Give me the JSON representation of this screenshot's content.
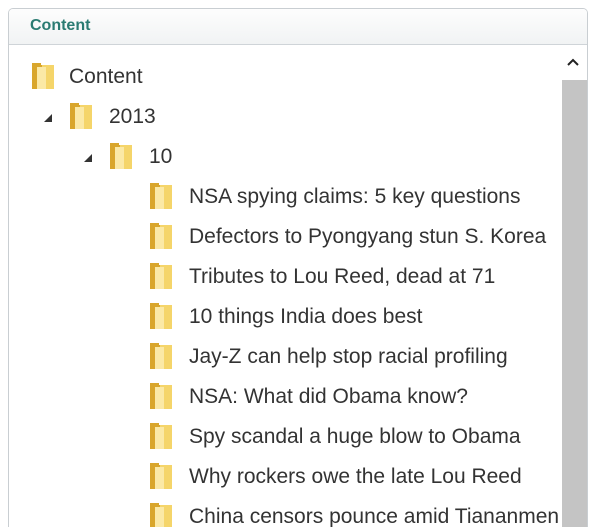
{
  "panel": {
    "title": "Content"
  },
  "tree": {
    "root": {
      "label": "Content",
      "icon": "folder-icon"
    },
    "year": {
      "label": "2013",
      "icon": "folder-icon",
      "expander": "collapse-triangle-icon"
    },
    "month": {
      "label": "10",
      "icon": "folder-icon",
      "expander": "collapse-triangle-icon"
    },
    "articles": [
      "NSA spying claims: 5 key questions",
      "Defectors to Pyongyang stun S. Korea",
      "Tributes to Lou Reed, dead at 71",
      "10 things India does best",
      "Jay-Z can help stop racial profiling",
      "NSA: What did Obama know?",
      "Spy scandal a huge blow to Obama",
      "Why rockers owe the late Lou Reed",
      "China censors pounce amid Tiananmen"
    ]
  },
  "scrollbar": {
    "up_icon": "chevron-up-icon"
  },
  "colors": {
    "header_text": "#2a7b72",
    "item_text": "#333333",
    "folder_light": "#f5d56a",
    "folder_dark": "#d9a62c",
    "scroll_thumb": "#c4c4c4"
  }
}
